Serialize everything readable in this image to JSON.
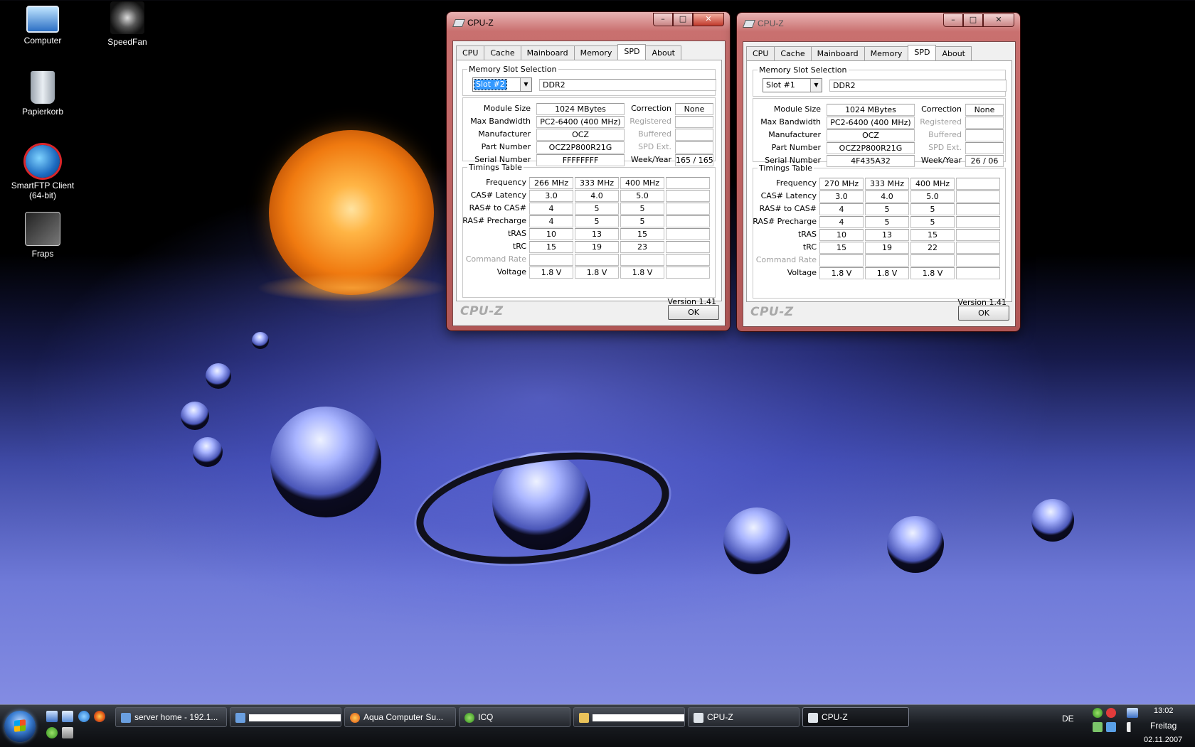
{
  "desktop": {
    "icons": [
      {
        "label": "Computer"
      },
      {
        "label": "SpeedFan"
      },
      {
        "label": "Papierkorb"
      },
      {
        "label": "SmartFTP Client (64-bit)"
      },
      {
        "label": "Fraps"
      }
    ]
  },
  "windows": [
    {
      "title": "CPU-Z",
      "tabs": [
        "CPU",
        "Cache",
        "Mainboard",
        "Memory",
        "SPD",
        "About"
      ],
      "active_tab": "SPD",
      "slot_legend": "Memory Slot Selection",
      "slot_value": "Slot #2",
      "memory_type": "DDR2",
      "labels": {
        "module_size": "Module Size",
        "max_bandwidth": "Max Bandwidth",
        "manufacturer": "Manufacturer",
        "part_number": "Part Number",
        "serial_number": "Serial Number",
        "correction": "Correction",
        "registered": "Registered",
        "buffered": "Buffered",
        "spd_ext": "SPD Ext.",
        "week_year": "Week/Year"
      },
      "module_size": "1024 MBytes",
      "max_bandwidth": "PC2-6400 (400 MHz)",
      "manufacturer": "OCZ",
      "part_number": "OCZ2P800R21G",
      "serial_number": "FFFFFFFF",
      "correction": "None",
      "week_year": "165 / 165",
      "timings": {
        "legend": "Timings Table",
        "rows": [
          {
            "label": "Frequency",
            "values": [
              "266 MHz",
              "333 MHz",
              "400 MHz",
              ""
            ]
          },
          {
            "label": "CAS# Latency",
            "values": [
              "3.0",
              "4.0",
              "5.0",
              ""
            ]
          },
          {
            "label": "RAS# to CAS#",
            "values": [
              "4",
              "5",
              "5",
              ""
            ]
          },
          {
            "label": "RAS# Precharge",
            "values": [
              "4",
              "5",
              "5",
              ""
            ]
          },
          {
            "label": "tRAS",
            "values": [
              "10",
              "13",
              "15",
              ""
            ]
          },
          {
            "label": "tRC",
            "values": [
              "15",
              "19",
              "23",
              ""
            ]
          },
          {
            "label": "Command Rate",
            "values": [
              "",
              "",
              "",
              ""
            ]
          },
          {
            "label": "Voltage",
            "values": [
              "1.8 V",
              "1.8 V",
              "1.8 V",
              ""
            ]
          }
        ]
      },
      "version": "Version 1.41",
      "brand": "CPU-Z",
      "ok_label": "OK"
    },
    {
      "title": "CPU-Z",
      "tabs": [
        "CPU",
        "Cache",
        "Mainboard",
        "Memory",
        "SPD",
        "About"
      ],
      "active_tab": "SPD",
      "slot_legend": "Memory Slot Selection",
      "slot_value": "Slot #1",
      "memory_type": "DDR2",
      "labels": {
        "module_size": "Module Size",
        "max_bandwidth": "Max Bandwidth",
        "manufacturer": "Manufacturer",
        "part_number": "Part Number",
        "serial_number": "Serial Number",
        "correction": "Correction",
        "registered": "Registered",
        "buffered": "Buffered",
        "spd_ext": "SPD Ext.",
        "week_year": "Week/Year"
      },
      "module_size": "1024 MBytes",
      "max_bandwidth": "PC2-6400 (400 MHz)",
      "manufacturer": "OCZ",
      "part_number": "OCZ2P800R21G",
      "serial_number": "4F435A32",
      "correction": "None",
      "week_year": "26 / 06",
      "timings": {
        "legend": "Timings Table",
        "rows": [
          {
            "label": "Frequency",
            "values": [
              "270 MHz",
              "333 MHz",
              "400 MHz",
              ""
            ]
          },
          {
            "label": "CAS# Latency",
            "values": [
              "3.0",
              "4.0",
              "5.0",
              ""
            ]
          },
          {
            "label": "RAS# to CAS#",
            "values": [
              "4",
              "5",
              "5",
              ""
            ]
          },
          {
            "label": "RAS# Precharge",
            "values": [
              "4",
              "5",
              "5",
              ""
            ]
          },
          {
            "label": "tRAS",
            "values": [
              "10",
              "13",
              "15",
              ""
            ]
          },
          {
            "label": "tRC",
            "values": [
              "15",
              "19",
              "22",
              ""
            ]
          },
          {
            "label": "Command Rate",
            "values": [
              "",
              "",
              "",
              ""
            ]
          },
          {
            "label": "Voltage",
            "values": [
              "1.8 V",
              "1.8 V",
              "1.8 V",
              ""
            ]
          }
        ]
      },
      "version": "Version 1.41",
      "brand": "CPU-Z",
      "ok_label": "OK"
    }
  ],
  "taskbar": {
    "buttons": [
      {
        "label": "server home - 192.1..."
      },
      {
        "label": ""
      },
      {
        "label": "Aqua Computer Su..."
      },
      {
        "label": "ICQ"
      },
      {
        "label": ""
      },
      {
        "label": "CPU-Z"
      },
      {
        "label": "CPU-Z"
      }
    ],
    "language": "DE",
    "time": "13:02",
    "day": "Freitag",
    "date": "02.11.2007"
  }
}
